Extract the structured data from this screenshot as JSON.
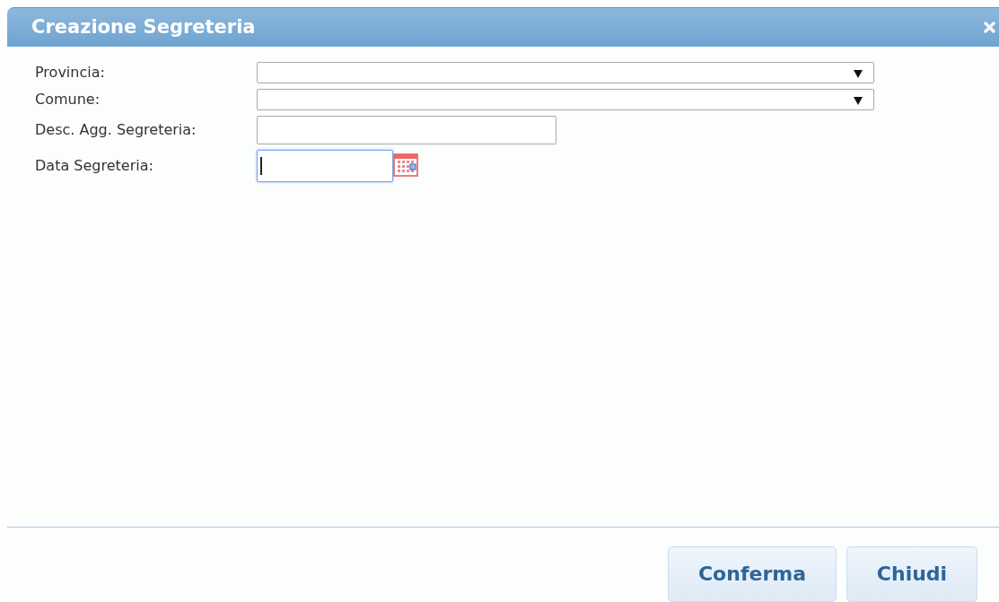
{
  "dialog": {
    "title": "Creazione Segreteria"
  },
  "fields": [
    {
      "label": "Provincia:",
      "kind": "select",
      "focused": false
    },
    {
      "label": "Comune:",
      "kind": "select",
      "focused": false
    },
    {
      "label": "Desc. Agg. Segreteria:",
      "kind": "text",
      "focused": false
    },
    {
      "label": "Data Segreteria:",
      "kind": "date",
      "focused": true
    }
  ],
  "buttons": [
    "Conferma",
    "Chiudi"
  ]
}
